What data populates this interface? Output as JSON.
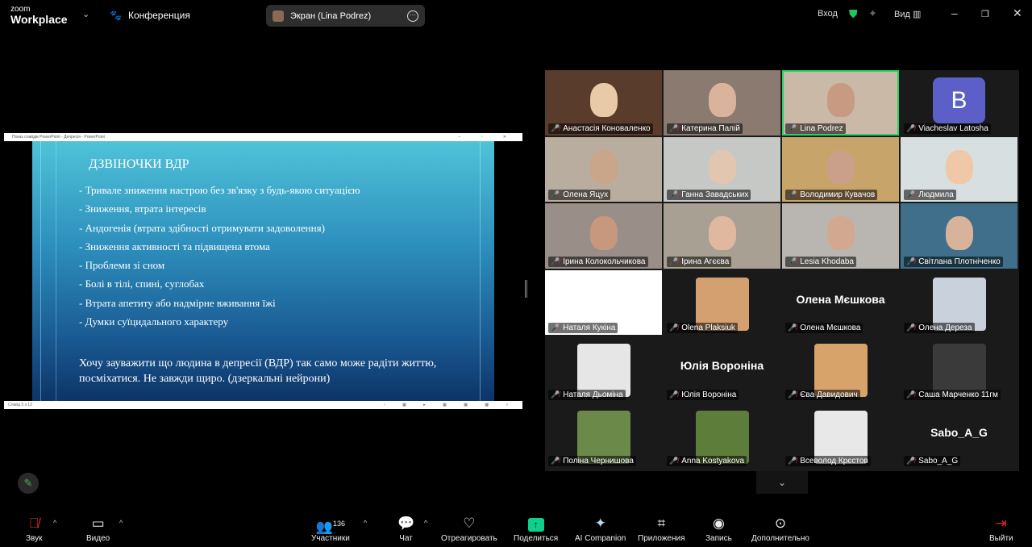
{
  "app": {
    "logo_small": "zoom",
    "logo_big": "Workplace",
    "meeting": "Конференция",
    "screen_label": "Экран (Lina Podrez)",
    "login": "Вход",
    "view": "Вид"
  },
  "slideshow": {
    "window_title": "Показ слайдів PowerPoint - Депресія - PowerPoint",
    "status": "Слайд 3 з 13",
    "title": "ДЗВІНОЧКИ ВДР",
    "bullets": [
      "- Тривале зниження настрою без зв'язку з будь-якою ситуацією",
      "- Зниження, втрата інтересів",
      "- Андогенія (втрата здібності отримувати задоволення)",
      "- Зниження активності та підвищена втома",
      "- Проблеми зі сном",
      "- Болі в тілі, спині, суглобах",
      "- Втрата апетиту або надмірне вживання їжі",
      "- Думки суїцидального характеру"
    ],
    "note": "Хочу зауважити що людина в депресії (ВДР) так само може радіти життю, посміхатися. Не завжди щиро. (дзеркальні нейрони)"
  },
  "participants": [
    {
      "name": "Анастасія Коноваленко",
      "kind": "video",
      "bg": "#5a3c2c",
      "face": "#e8c9a8"
    },
    {
      "name": "Катерина Палій",
      "kind": "video",
      "bg": "#8a7a70",
      "face": "#d9b39b"
    },
    {
      "name": "Lina Podrez",
      "kind": "video",
      "bg": "#c9b9a6",
      "face": "#c89a82",
      "active": true
    },
    {
      "name": "Viacheslav Latosha",
      "kind": "avatar",
      "letter": "B"
    },
    {
      "name": "Олена Яцух",
      "kind": "video",
      "bg": "#b8ad9e",
      "face": "#c9a58a"
    },
    {
      "name": "Ганна Завадських",
      "kind": "video",
      "bg": "#c5c8c4",
      "face": "#e3c6b0"
    },
    {
      "name": "Володимир Кувачов",
      "kind": "video",
      "bg": "#c7a46a",
      "face": "#caa08a"
    },
    {
      "name": "Людмила",
      "kind": "video",
      "bg": "#d8dfe0",
      "face": "#f0c8a8"
    },
    {
      "name": "Ірина Колокольчикова",
      "kind": "video",
      "bg": "#9a8e88",
      "face": "#c8987e"
    },
    {
      "name": "Ірина Агєєва",
      "kind": "video",
      "bg": "#a8a092",
      "face": "#e0b8a0"
    },
    {
      "name": "Lesia Khodaba",
      "kind": "video",
      "bg": "#b9b5b0",
      "face": "#d2a890"
    },
    {
      "name": "Світлана Плотніченко",
      "kind": "video",
      "bg": "#3f6f8a",
      "face": "#d8b29a"
    },
    {
      "name": "Наталя Кукіна",
      "kind": "video",
      "bg": "#ffffff",
      "face": "#ffffff"
    },
    {
      "name": "Olena Plaksiuk",
      "kind": "photo",
      "bg": "#d4a070"
    },
    {
      "name": "Олена Мєшкова",
      "kind": "text",
      "big": "Олена Мєшкова"
    },
    {
      "name": "Олена Дереза",
      "kind": "photo",
      "bg": "#c9d1dc"
    },
    {
      "name": "Наталя Дьоміна",
      "kind": "photo",
      "bg": "#e6e6e6"
    },
    {
      "name": "Юлія Вороніна",
      "kind": "text",
      "big": "Юлія Вороніна"
    },
    {
      "name": "Єва Давидович",
      "kind": "photo",
      "bg": "#d8a36a"
    },
    {
      "name": "Саша Марченко 11гм",
      "kind": "photo",
      "bg": "#3a3a3a"
    },
    {
      "name": "Поліна Чернишова",
      "kind": "photo",
      "bg": "#6b8a4a"
    },
    {
      "name": "Anna Kostyakova",
      "kind": "photo",
      "bg": "#5d7d3a"
    },
    {
      "name": "Всеволод Крєстов",
      "kind": "photo",
      "bg": "#e8e8e8"
    },
    {
      "name": "Sabo_A_G",
      "kind": "text",
      "big": "Sabo_A_G"
    }
  ],
  "toolbar": {
    "audio": "Звук",
    "video": "Видео",
    "participants": "Участники",
    "participants_count": "136",
    "chat": "Чат",
    "react": "Отреагировать",
    "share": "Поделиться",
    "ai": "AI Companion",
    "apps": "Приложения",
    "record": "Запись",
    "more": "Дополнительно",
    "leave": "Выйти"
  },
  "colors": {
    "active_speaker": "#25d366",
    "share": "#0ecf8c",
    "leave": "#e02828",
    "shield": "#22c55e"
  }
}
